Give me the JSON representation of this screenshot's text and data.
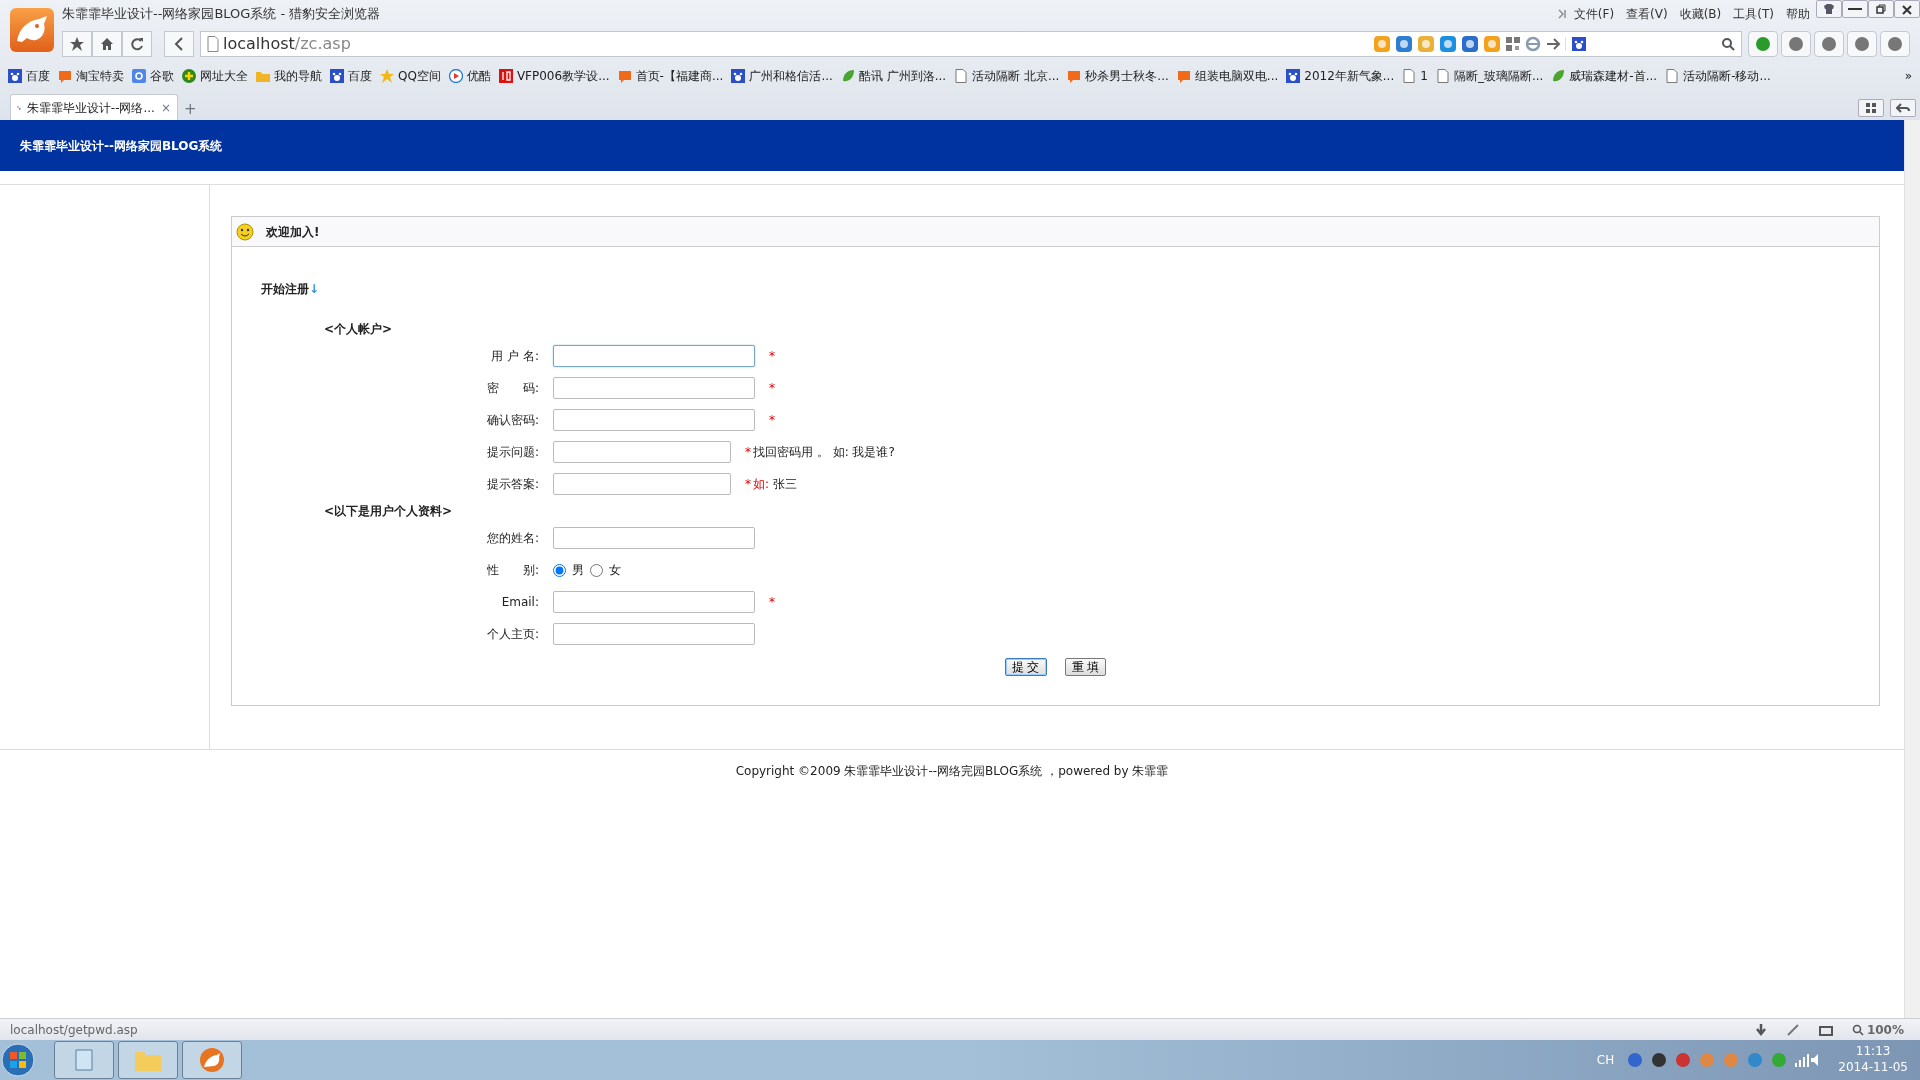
{
  "window": {
    "title": "朱霏霏毕业设计--网络家园BLOG系统 - 猎豹安全浏览器",
    "menu": [
      "文件(F)",
      "查看(V)",
      "收藏(B)",
      "工具(T)",
      "帮助"
    ]
  },
  "address": {
    "host": "localhost",
    "path": "/zc.asp"
  },
  "bookmarks": [
    {
      "label": "百度",
      "kind": "paw"
    },
    {
      "label": "淘宝特卖",
      "kind": "tao"
    },
    {
      "label": "谷歌",
      "kind": "g"
    },
    {
      "label": "网址大全",
      "kind": "plus"
    },
    {
      "label": "我的导航",
      "kind": "folder"
    },
    {
      "label": "百度",
      "kind": "paw"
    },
    {
      "label": "QQ空间",
      "kind": "star"
    },
    {
      "label": "优酷",
      "kind": "play"
    },
    {
      "label": "VFP006教学设...",
      "kind": "pai"
    },
    {
      "label": "首页-【福建商...",
      "kind": "tao"
    },
    {
      "label": "广州和格信活...",
      "kind": "paw"
    },
    {
      "label": "酷讯 广州到洛...",
      "kind": "leaf"
    },
    {
      "label": "活动隔断 北京...",
      "kind": "page"
    },
    {
      "label": "秒杀男士秋冬...",
      "kind": "tao"
    },
    {
      "label": "组装电脑双电...",
      "kind": "tao"
    },
    {
      "label": "2012年新气象...",
      "kind": "paw"
    },
    {
      "label": "1",
      "kind": "page"
    },
    {
      "label": "隔断_玻璃隔断...",
      "kind": "page"
    },
    {
      "label": "威瑞森建材-首...",
      "kind": "leaf"
    },
    {
      "label": "活动隔断-移动...",
      "kind": "page"
    }
  ],
  "more_bookmarks": "»",
  "tabs": [
    {
      "label": "朱霏霏毕业设计--网络...",
      "close": "×",
      "selected": true
    }
  ],
  "new_tab": "+",
  "page": {
    "header": "朱霏霏毕业设计--网络家园BLOG系统",
    "welcome": "欢迎加入!",
    "start": "开始注册",
    "start_arrow": "↓",
    "groups": [
      {
        "heading": "<个人帐户>",
        "fields": [
          {
            "label": "用 户 名:",
            "kind": "text",
            "focused": true,
            "mark": "*"
          },
          {
            "label": "密　　码:",
            "kind": "password",
            "focused": false,
            "mark": "*"
          },
          {
            "label": "确认密码:",
            "kind": "password",
            "focused": false,
            "mark": "*"
          },
          {
            "label": "提示问题:",
            "kind": "short",
            "focused": false,
            "mark": "*",
            "hint": "找回密码用 。 如: 我是谁?"
          },
          {
            "label": "提示答案:",
            "kind": "short",
            "focused": false,
            "mark": "*",
            "hint_red": "如:",
            "hint": "张三"
          }
        ]
      },
      {
        "heading": "<以下是用户个人资料>",
        "fields": [
          {
            "label": "您的姓名:",
            "kind": "text",
            "focused": false
          },
          {
            "label": "性　　别:",
            "kind": "radio",
            "options": [
              {
                "label": "男",
                "selected": true
              },
              {
                "label": "女",
                "selected": false
              }
            ]
          },
          {
            "label": "Email:",
            "kind": "text",
            "focused": false,
            "mark": "*"
          },
          {
            "label": "个人主页:",
            "kind": "text",
            "focused": false
          }
        ]
      }
    ],
    "buttons": [
      {
        "label": "提 交",
        "default": true
      },
      {
        "label": "重 填",
        "default": false
      }
    ],
    "footer": "Copyright ©2009 朱霏霏毕业设计--网络完园BLOG系统 ，powered by 朱霏霏"
  },
  "status_bar": {
    "text": "localhost/getpwd.asp",
    "zoom": "100%"
  },
  "taskbar": {
    "lang": "CH",
    "time": "11:13",
    "date": "2014-11-05"
  }
}
